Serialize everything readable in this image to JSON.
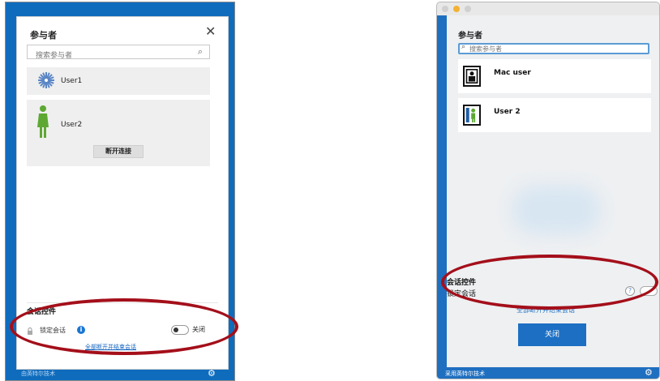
{
  "windows_panel": {
    "title": "参与者",
    "close_glyph": "✕",
    "search": {
      "placeholder": "搜索参与者"
    },
    "participants": [
      {
        "name": "User1",
        "avatar": "gear-avatar-icon"
      },
      {
        "name": "User2",
        "avatar": "female-person-icon",
        "action_label": "断开连接"
      }
    ],
    "section_title": "会话控件",
    "lock_label": "锁定会话",
    "info_glyph": "i",
    "toggle_label": "关闭",
    "end_link": "全部断开并结束会话",
    "bottom_text": "由英特尔技术",
    "gear_glyph": "⚙"
  },
  "mac_panel": {
    "title": "参与者",
    "search": {
      "placeholder": "搜索参与者"
    },
    "participants": [
      {
        "name": "Mac user",
        "avatar": "framed-portrait-icon"
      },
      {
        "name": "User 2",
        "avatar": "framed-person-icon"
      }
    ],
    "section_title": "会话控件",
    "lock_label": "锁定会话",
    "help_glyph": "?",
    "end_link": "全部断开并结束会话",
    "close_button": "关闭",
    "bottom_text": "采用英特尔技术",
    "gear_glyph": "⚙"
  },
  "colors": {
    "accent_blue": "#1f6fc0",
    "annotation_red": "#a40f1a",
    "info_blue": "#1976d2",
    "avatar_green": "#5da832"
  }
}
